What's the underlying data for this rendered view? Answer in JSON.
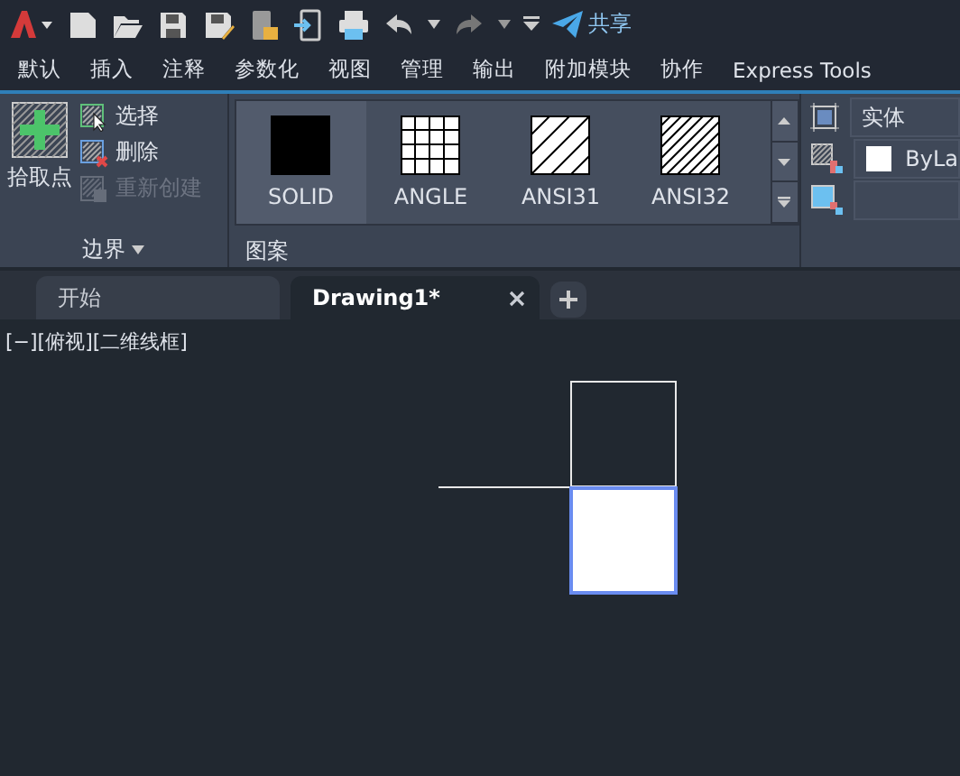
{
  "quick_access": {
    "share_label": "共享"
  },
  "menu_tabs": [
    {
      "label": "默认"
    },
    {
      "label": "插入"
    },
    {
      "label": "注释"
    },
    {
      "label": "参数化"
    },
    {
      "label": "视图"
    },
    {
      "label": "管理"
    },
    {
      "label": "输出"
    },
    {
      "label": "附加模块"
    },
    {
      "label": "协作"
    },
    {
      "label": "Express Tools"
    }
  ],
  "boundary_panel": {
    "pick_label": "拾取点",
    "tools": [
      {
        "label": "选择",
        "kind": "select",
        "disabled": false
      },
      {
        "label": "删除",
        "kind": "delete",
        "disabled": false
      },
      {
        "label": "重新创建",
        "kind": "recreate",
        "disabled": true
      }
    ],
    "title": "边界"
  },
  "pattern_panel": {
    "patterns": [
      {
        "label": "SOLID",
        "kind": "solid",
        "selected": true
      },
      {
        "label": "ANGLE",
        "kind": "grid",
        "selected": false
      },
      {
        "label": "ANSI31",
        "kind": "sparse",
        "selected": false
      },
      {
        "label": "ANSI32",
        "kind": "dense",
        "selected": false
      }
    ],
    "title": "图案"
  },
  "properties_panel": {
    "type_value": "实体",
    "color_value": "ByLa"
  },
  "doc_tabs": [
    {
      "label": "开始",
      "selected": false
    },
    {
      "label": "Drawing1*",
      "selected": true
    }
  ],
  "viewport_label": "[−][俯视][二维线框]"
}
